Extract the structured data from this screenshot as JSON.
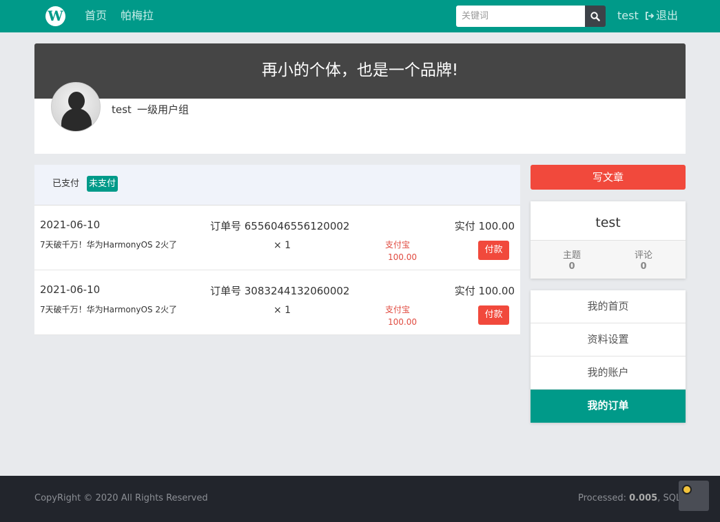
{
  "nav": {
    "logo_letter": "W",
    "links": [
      "首页",
      "帕梅拉"
    ],
    "search_placeholder": "关键词",
    "user": "test",
    "logout": "退出"
  },
  "profile": {
    "banner_title": "再小的个体，也是一个品牌!",
    "name": "test",
    "group": "一级用户组"
  },
  "orders": {
    "tabs": {
      "paid": "已支付",
      "unpaid": "未支付"
    },
    "items": [
      {
        "date": "2021-06-10",
        "order_no": "订单号 6556046556120002",
        "total": "实付 100.00",
        "title": "7天破千万！华为HarmonyOS 2火了",
        "qty": "× 1",
        "method": "支付宝",
        "amount": "100.00",
        "pay_label": "付款"
      },
      {
        "date": "2021-06-10",
        "order_no": "订单号 3083244132060002",
        "total": "实付 100.00",
        "title": "7天破千万！华为HarmonyOS 2火了",
        "qty": "× 1",
        "method": "支付宝",
        "amount": "100.00",
        "pay_label": "付款"
      }
    ]
  },
  "sidebar": {
    "write_button": "写文章",
    "user_name": "test",
    "stats": [
      {
        "label": "主题",
        "value": "0"
      },
      {
        "label": "评论",
        "value": "0"
      }
    ],
    "menu": [
      "我的首页",
      "资料设置",
      "我的账户",
      "我的订单"
    ]
  },
  "footer": {
    "copyright": "CopyRight © 2020 All Rights Reserved",
    "processed_label": "Processed: ",
    "processed_value": "0.005",
    "sql_label": ", SQL: "
  },
  "colors": {
    "brand": "#009a89",
    "danger": "#f1493c",
    "footer_bg": "#22252c",
    "banner_bg": "#454545"
  }
}
